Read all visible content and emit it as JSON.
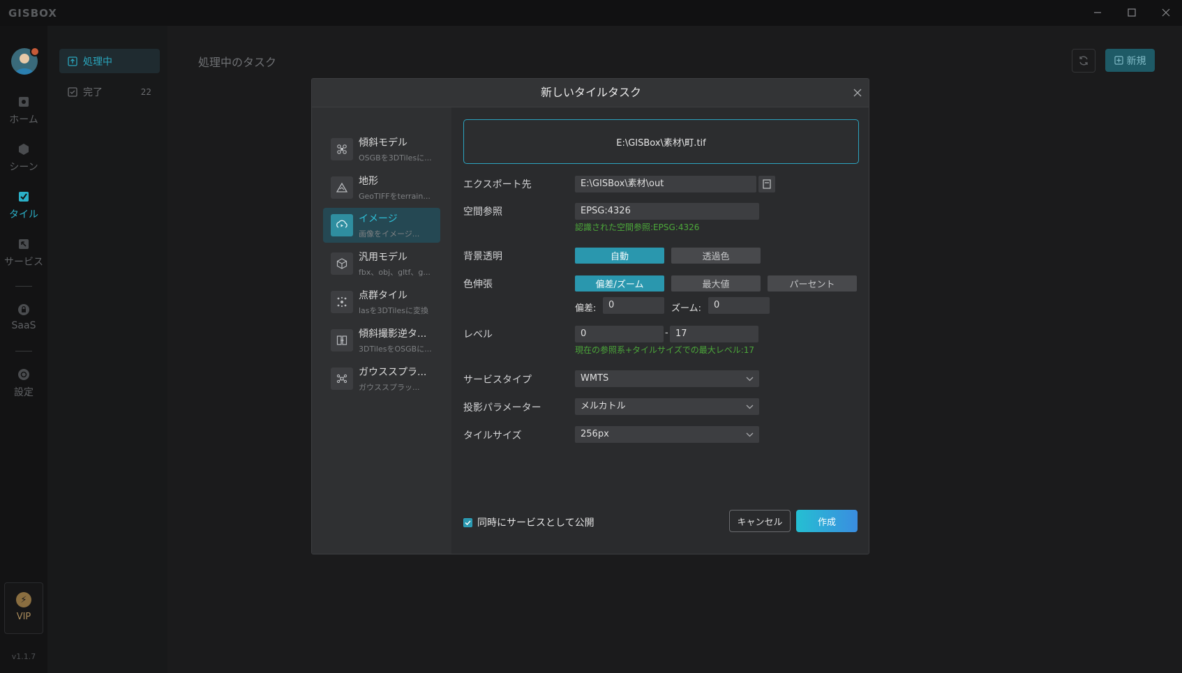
{
  "app": {
    "logo_text": "GISBOX",
    "version": "v1.1.7"
  },
  "window_controls": {
    "minimize": "—",
    "maximize": "☐",
    "close": "✕"
  },
  "rail": {
    "items": [
      {
        "label": "ホーム",
        "icon": "home-icon"
      },
      {
        "label": "シーン",
        "icon": "scene-icon"
      },
      {
        "label": "タイル",
        "icon": "tile-icon",
        "active": true
      },
      {
        "label": "サービス",
        "icon": "service-icon"
      },
      {
        "label": "SaaS",
        "icon": "lock-icon"
      },
      {
        "label": "設定",
        "icon": "gear-icon"
      }
    ],
    "vip_label": "VIP"
  },
  "subnav": {
    "items": [
      {
        "label": "処理中",
        "active": true
      },
      {
        "label": "完了",
        "count": "22"
      }
    ]
  },
  "main": {
    "title": "処理中のタスク",
    "new_button": "新規"
  },
  "dialog": {
    "title": "新しいタイルタスク",
    "types": [
      {
        "name": "傾斜モデル",
        "desc": "OSGBを3DTilesに...",
        "icon": "drone-icon"
      },
      {
        "name": "地形",
        "desc": "GeoTIFFをterrain...",
        "icon": "terrain-icon"
      },
      {
        "name": "イメージ",
        "desc": "画像をイメージ...",
        "icon": "image-icon",
        "active": true
      },
      {
        "name": "汎用モデル",
        "desc": "fbx、obj、gltf、g...",
        "icon": "cube-icon"
      },
      {
        "name": "点群タイル",
        "desc": "lasを3DTilesに変換",
        "icon": "pointcloud-icon"
      },
      {
        "name": "傾斜撮影逆タ...",
        "desc": "3DTilesをOSGBに...",
        "icon": "reverse-icon"
      },
      {
        "name": "ガウススプラ...",
        "desc": "ガウススプラッ...",
        "icon": "gaussian-icon"
      }
    ],
    "file_path": "E:\\GISBox\\素材\\町.tif",
    "export_label": "エクスポート先",
    "export_value": "E:\\GISBox\\素材\\out",
    "crs_label": "空間参照",
    "crs_value": "EPSG:4326",
    "crs_note": "認識された空間参照:EPSG:4326",
    "bg_label": "背景透明",
    "bg_options": [
      "自動",
      "透過色"
    ],
    "stretch_label": "色伸張",
    "stretch_options": [
      "偏差/ズーム",
      "最大値",
      "パーセント"
    ],
    "deviation_label": "偏差:",
    "deviation_value": "0",
    "zoom_label": "ズーム:",
    "zoom_value": "0",
    "level_label": "レベル",
    "level_min": "0",
    "level_sep": "-",
    "level_max": "17",
    "level_note": "現在の参照系+タイルサイズでの最大レベル:17",
    "service_type_label": "サービスタイプ",
    "service_type_value": "WMTS",
    "projection_label": "投影パラメーター",
    "projection_value": "メルカトル",
    "tile_size_label": "タイルサイズ",
    "tile_size_value": "256px",
    "publish_label": "同時にサービスとして公開",
    "cancel_label": "キャンセル",
    "create_label": "作成"
  }
}
